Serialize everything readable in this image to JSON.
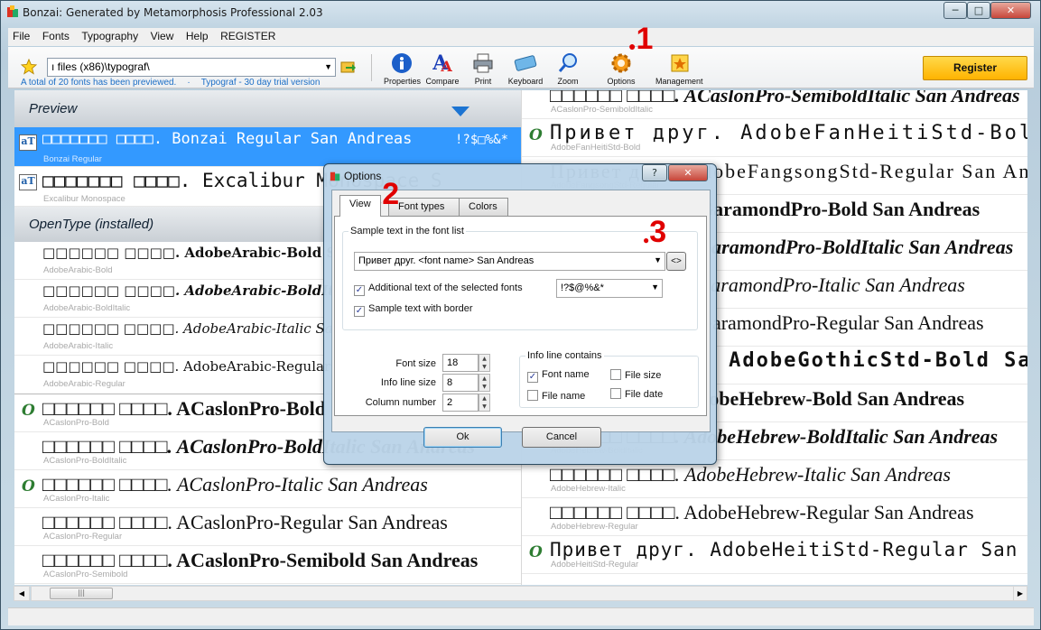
{
  "window": {
    "title": "Bonzai: Generated by Metamorphosis Professional 2.03"
  },
  "menu": [
    "File",
    "Fonts",
    "Typography",
    "View",
    "Help",
    "REGISTER"
  ],
  "toolbar": {
    "path_value": "ı files (x86)\\typograf\\",
    "status_left": "A total of 20 fonts has been previewed.",
    "status_right": "Typograf - 30 day trial version",
    "buttons": [
      "Properties",
      "Compare",
      "Print",
      "Keyboard",
      "Zoom",
      "Options",
      "Management"
    ],
    "register": "Register"
  },
  "left": {
    "preview_header": "Preview",
    "preview": [
      {
        "sample": "□□□□□□□ □□□□. Bonzai Regular San Andreas",
        "extra": "!?$□%&*",
        "info": "Bonzai Regular"
      },
      {
        "sample": "□□□□□□□ □□□□. Excalibur Monospace S",
        "info": "Excalibur Monospace"
      }
    ],
    "opentype_header": "OpenType (installed)",
    "fonts": [
      {
        "sample": "□□□□□□ □□□□. AdobeArabic-Bold San Andreas",
        "info": "AdobeArabic-Bold"
      },
      {
        "sample": "□□□□□□ □□□□. AdobeArabic-BoldItalic San Andreas",
        "info": "AdobeArabic-BoldItalic"
      },
      {
        "sample": "□□□□□□ □□□□. AdobeArabic-Italic San Andreas",
        "info": "AdobeArabic-Italic"
      },
      {
        "sample": "□□□□□□ □□□□. AdobeArabic-Regular San Andreas",
        "info": "AdobeArabic-Regular"
      },
      {
        "sample": "□□□□□□ □□□□. ACaslonPro-Bold San Andreas",
        "info": "ACaslonPro-Bold"
      },
      {
        "sample": "□□□□□□ □□□□. ACaslonPro-BoldItalic San Andreas",
        "info": "ACaslonPro-BoldItalic"
      },
      {
        "sample": "□□□□□□ □□□□. ACaslonPro-Italic San Andreas",
        "info": "ACaslonPro-Italic"
      },
      {
        "sample": "□□□□□□ □□□□. ACaslonPro-Regular San Andreas",
        "info": "ACaslonPro-Regular"
      },
      {
        "sample": "□□□□□□ □□□□. ACaslonPro-Semibold San Andreas",
        "info": "ACaslonPro-Semibold"
      }
    ]
  },
  "right": {
    "fonts": [
      {
        "sample": "□□□□□□ □□□□. ACaslonPro-SemiboldItalic San Andreas",
        "info": "ACaslonPro-SemiboldItalic"
      },
      {
        "sample": "Привет друг. AdobeFanHeitiStd-Bold San Andreas",
        "info": "AdobeFanHeitiStd-Bold"
      },
      {
        "sample": "Привет друг. AdobeFangsongStd-Regular San Andreas",
        "info": "AdobeFangsongStd-Regular"
      },
      {
        "sample": "□□□□□□ □□□□. AGaramondPro-Bold San Andreas",
        "info": "AGaramondPro-Bold"
      },
      {
        "sample": "□□□□□□ □□□□. AGaramondPro-BoldItalic San Andreas",
        "info": "AGaramondPro-BoldItalic"
      },
      {
        "sample": "□□□□□□ □□□□. AGaramondPro-Italic San Andreas",
        "info": "AGaramondPro-Italic"
      },
      {
        "sample": "□□□□□□ □□□□. AGaramondPro-Regular San Andreas",
        "info": "AGaramondPro-Regular"
      },
      {
        "sample": "Привет друг. AdobeGothicStd-Bold San Andreas",
        "info": "AdobeGothicStd-Bold"
      },
      {
        "sample": "□□□□□□ □□□□. AdobeHebrew-Bold San Andreas",
        "info": "AdobeHebrew-Bold"
      },
      {
        "sample": "□□□□□□ □□□□. AdobeHebrew-BoldItalic San Andreas",
        "info": "AdobeHebrew-BoldItalic"
      },
      {
        "sample": "□□□□□□ □□□□. AdobeHebrew-Italic San Andreas",
        "info": "AdobeHebrew-Italic"
      },
      {
        "sample": "□□□□□□ □□□□. AdobeHebrew-Regular San Andreas",
        "info": "AdobeHebrew-Regular"
      },
      {
        "sample": "Привет друг. AdobeHeitiStd-Regular San Andreas",
        "info": "AdobeHeitiStd-Regular"
      }
    ]
  },
  "dialog": {
    "title": "Options",
    "help": "?",
    "close": "✕",
    "tabs": [
      "View",
      "Font types",
      "Colors"
    ],
    "sample_group": "Sample text in the font list",
    "sample_value": "Привет друг. <font name> San Andreas",
    "sample_btn": "<>",
    "additional_label": "Additional text of the selected fonts",
    "additional_value": "!?$@%&*",
    "border_label": "Sample text with border",
    "font_size_label": "Font size",
    "font_size": "18",
    "info_size_label": "Info line size",
    "info_size": "8",
    "columns_label": "Column number",
    "columns": "2",
    "info_group": "Info line contains",
    "info_font_name": "Font name",
    "info_file_size": "File size",
    "info_file_name": "File name",
    "info_file_date": "File date",
    "ok": "Ok",
    "cancel": "Cancel"
  },
  "annotations": [
    "1",
    "2",
    "3"
  ]
}
